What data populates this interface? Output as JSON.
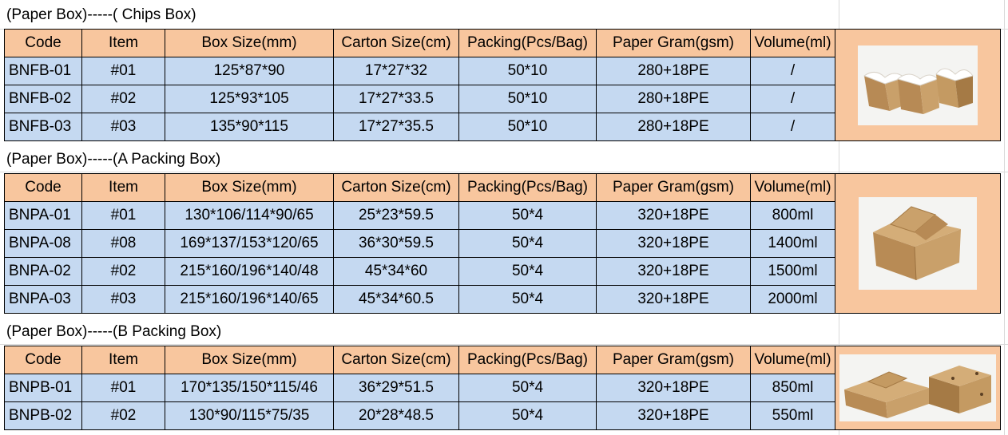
{
  "sections": [
    {
      "title": "(Paper Box)-----( Chips Box)",
      "headers": [
        "Code",
        "Item",
        "Box Size(mm)",
        "Carton Size(cm)",
        "Packing(Pcs/Bag)",
        "Paper Gram(gsm)",
        "Volume(ml)"
      ],
      "rows": [
        [
          "BNFB-01",
          "#01",
          "125*87*90",
          "17*27*32",
          "50*10",
          "280+18PE",
          "/"
        ],
        [
          "BNFB-02",
          "#02",
          "125*93*105",
          "17*27*33.5",
          "50*10",
          "280+18PE",
          "/"
        ],
        [
          "BNFB-03",
          "#03",
          "135*90*115",
          "17*27*35.5",
          "50*10",
          "280+18PE",
          "/"
        ]
      ],
      "image": "chips-box-photo"
    },
    {
      "title": "(Paper Box)-----(A Packing Box)",
      "headers": [
        "Code",
        "Item",
        "Box Size(mm)",
        "Carton Size(cm)",
        "Packing(Pcs/Bag)",
        "Paper Gram(gsm)",
        "Volume(ml)"
      ],
      "rows": [
        [
          "BNPA-01",
          "#01",
          "130*106/114*90/65",
          "25*23*59.5",
          "50*4",
          "320+18PE",
          "800ml"
        ],
        [
          "BNPA-08",
          "#08",
          "169*137/153*120/65",
          "36*30*59.5",
          "50*4",
          "320+18PE",
          "1400ml"
        ],
        [
          "BNPA-02",
          "#02",
          "215*160/196*140/48",
          "45*34*60",
          "50*4",
          "320+18PE",
          "1500ml"
        ],
        [
          "BNPA-03",
          "#03",
          "215*160/196*140/65",
          "45*34*60.5",
          "50*4",
          "320+18PE",
          "2000ml"
        ]
      ],
      "image": "a-packing-box-photo"
    },
    {
      "title": "(Paper Box)-----(B Packing Box)",
      "headers": [
        "Code",
        "Item",
        "Box Size(mm)",
        "Carton Size(cm)",
        "Packing(Pcs/Bag)",
        "Paper Gram(gsm)",
        "Volume(ml)"
      ],
      "rows": [
        [
          "BNPB-01",
          "#01",
          "170*135/150*115/46",
          "36*29*51.5",
          "50*4",
          "320+18PE",
          "850ml"
        ],
        [
          "BNPB-02",
          "#02",
          "130*90/115*75/35",
          "20*28*48.5",
          "50*4",
          "320+18PE",
          "550ml"
        ]
      ],
      "image": "b-packing-box-photo"
    }
  ],
  "colors": {
    "header_bg": "#f8c69e",
    "row_bg": "#c5d9f1",
    "kraft": "#c49a62",
    "kraft_dark": "#a57a45"
  }
}
